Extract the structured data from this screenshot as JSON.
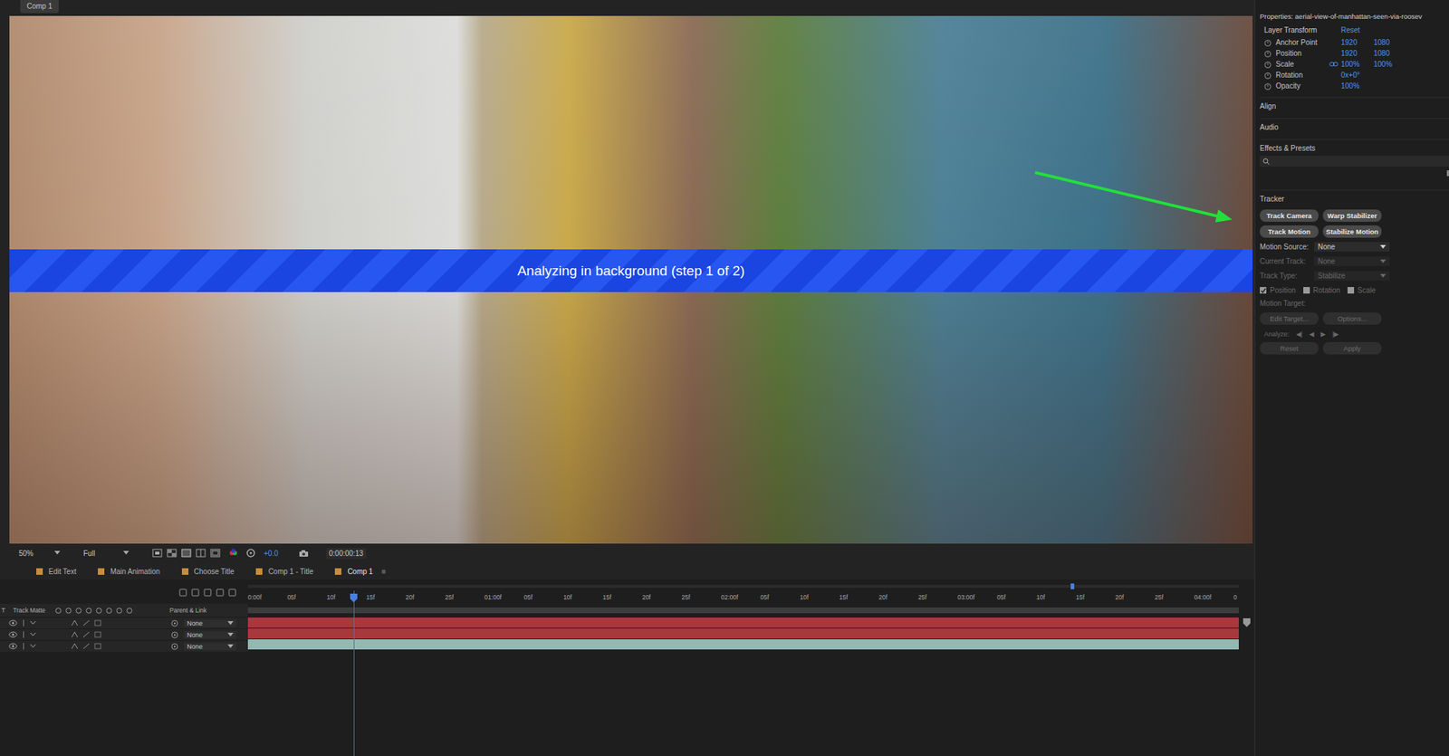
{
  "comp_tab": {
    "label": "Comp 1"
  },
  "viewer": {
    "status": "Analyzing in background (step 1 of 2)",
    "zoom": "50%",
    "resolution": "Full",
    "exposure": "+0.0",
    "timecode": "0:00:00:13"
  },
  "timeline": {
    "tabs": [
      {
        "label": "Edit Text",
        "selected": false
      },
      {
        "label": "Main Animation",
        "selected": false
      },
      {
        "label": "Choose Title",
        "selected": false
      },
      {
        "label": "Comp 1 - Title",
        "selected": false
      },
      {
        "label": "Comp 1",
        "selected": true
      }
    ],
    "tab_menu": "≡",
    "ruler": [
      "0:00f",
      "05f",
      "10f",
      "15f",
      "20f",
      "25f",
      "01:00f",
      "05f",
      "10f",
      "15f",
      "20f",
      "25f",
      "02:00f",
      "05f",
      "10f",
      "15f",
      "20f",
      "25f",
      "03:00f",
      "05f",
      "10f",
      "15f",
      "20f",
      "25f",
      "04:00f",
      "0"
    ],
    "playhead": 0.107,
    "work_area_end": 0.83,
    "columns": {
      "t": "T",
      "track_matte": "Track Matte",
      "parent": "Parent & Link"
    },
    "layers": [
      {
        "parent": "None",
        "color": "#a8383c"
      },
      {
        "parent": "None",
        "color": "#a8383c"
      },
      {
        "parent": "None",
        "color": "#93b9b3"
      }
    ]
  },
  "properties": {
    "title": "Properties: aerial-view-of-manhattan-seen-via-roosev",
    "menu": "≡",
    "section": "Layer Transform",
    "reset": "Reset",
    "rows": [
      {
        "label": "Anchor Point",
        "values": [
          "1920",
          "1080"
        ],
        "linked": false
      },
      {
        "label": "Position",
        "values": [
          "1920",
          "1080"
        ],
        "linked": false
      },
      {
        "label": "Scale",
        "values": [
          "100%",
          "100%"
        ],
        "linked": true
      },
      {
        "label": "Rotation",
        "values": [
          "0x+0°"
        ],
        "linked": false
      },
      {
        "label": "Opacity",
        "values": [
          "100%"
        ],
        "linked": false
      }
    ]
  },
  "panels": [
    {
      "label": "Align"
    },
    {
      "label": "Audio"
    }
  ],
  "effects": {
    "title": "Effects & Presets",
    "menu": "≡"
  },
  "tracker": {
    "title": "Tracker",
    "menu": "≡",
    "buttons": [
      {
        "label": "Track Camera",
        "disabled": false
      },
      {
        "label": "Warp Stabilizer",
        "disabled": false
      },
      {
        "label": "Track Motion",
        "disabled": false
      },
      {
        "label": "Stabilize Motion",
        "disabled": false
      }
    ],
    "fields": [
      {
        "label": "Motion Source:",
        "value": "None",
        "disabled": false
      },
      {
        "label": "Current Track:",
        "value": "None",
        "disabled": true
      },
      {
        "label": "Track Type:",
        "value": "Stabilize",
        "disabled": true
      }
    ],
    "checkboxes": [
      {
        "label": "Position",
        "checked": true,
        "disabled": true
      },
      {
        "label": "Rotation",
        "checked": false,
        "disabled": true
      },
      {
        "label": "Scale",
        "checked": false,
        "disabled": true
      }
    ],
    "motion_target": "Motion Target:",
    "target_buttons": [
      {
        "label": "Edit Target...",
        "disabled": true
      },
      {
        "label": "Options...",
        "disabled": true
      }
    ],
    "analyze": {
      "label": "Analyze:",
      "controls": [
        "◀|",
        "◀",
        "▶",
        "|▶"
      ],
      "disabled": true
    },
    "actions": [
      {
        "label": "Reset",
        "disabled": true
      },
      {
        "label": "Apply",
        "disabled": true
      }
    ]
  }
}
